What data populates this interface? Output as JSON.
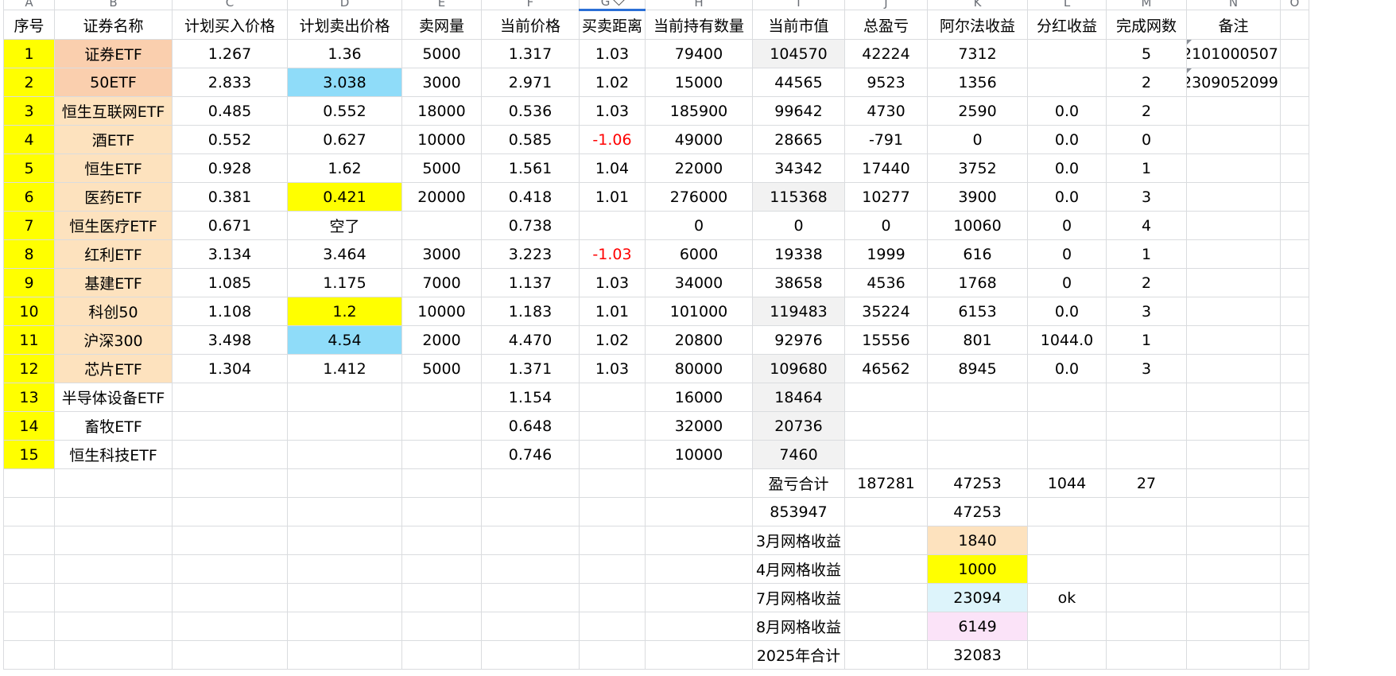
{
  "column_letters": [
    "A",
    "B",
    "C",
    "D",
    "E",
    "F",
    "G",
    "H",
    "I",
    "J",
    "K",
    "L",
    "M",
    "N",
    "O"
  ],
  "headers": [
    "序号",
    "证券名称",
    "计划买入价格",
    "计划卖出价格",
    "卖网量",
    "当前价格",
    "买卖距离",
    "当前持有数量",
    "当前市值",
    "总盈亏",
    "阿尔法收益",
    "分红收益",
    "完成网数",
    "备注"
  ],
  "rows": [
    {
      "no": "1",
      "name": "证券ETF",
      "buy": "1.267",
      "sell": "1.36",
      "qty": "5000",
      "price": "1.317",
      "dist": "1.03",
      "hold": "79400",
      "value": "104570",
      "pnl": "42224",
      "alpha": "7312",
      "div": "",
      "grids": "5",
      "note": "2101000507"
    },
    {
      "no": "2",
      "name": "50ETF",
      "buy": "2.833",
      "sell": "3.038",
      "qty": "3000",
      "price": "2.971",
      "dist": "1.02",
      "hold": "15000",
      "value": "44565",
      "pnl": "9523",
      "alpha": "1356",
      "div": "",
      "grids": "2",
      "note": "2309052099"
    },
    {
      "no": "3",
      "name": "恒生互联网ETF",
      "buy": "0.485",
      "sell": "0.552",
      "qty": "18000",
      "price": "0.536",
      "dist": "1.03",
      "hold": "185900",
      "value": "99642",
      "pnl": "4730",
      "alpha": "2590",
      "div": "0.0",
      "grids": "2",
      "note": ""
    },
    {
      "no": "4",
      "name": "酒ETF",
      "buy": "0.552",
      "sell": "0.627",
      "qty": "10000",
      "price": "0.585",
      "dist": "-1.06",
      "hold": "49000",
      "value": "28665",
      "pnl": "-791",
      "alpha": "0",
      "div": "0.0",
      "grids": "0",
      "note": ""
    },
    {
      "no": "5",
      "name": "恒生ETF",
      "buy": "0.928",
      "sell": "1.62",
      "qty": "5000",
      "price": "1.561",
      "dist": "1.04",
      "hold": "22000",
      "value": "34342",
      "pnl": "17440",
      "alpha": "3752",
      "div": "0.0",
      "grids": "1",
      "note": ""
    },
    {
      "no": "6",
      "name": "医药ETF",
      "buy": "0.381",
      "sell": "0.421",
      "qty": "20000",
      "price": "0.418",
      "dist": "1.01",
      "hold": "276000",
      "value": "115368",
      "pnl": "10277",
      "alpha": "3900",
      "div": "0.0",
      "grids": "3",
      "note": ""
    },
    {
      "no": "7",
      "name": "恒生医疗ETF",
      "buy": "0.671",
      "sell": "空了",
      "qty": "",
      "price": "0.738",
      "dist": "",
      "hold": "0",
      "value": "0",
      "pnl": "0",
      "alpha": "10060",
      "div": "0",
      "grids": "4",
      "note": ""
    },
    {
      "no": "8",
      "name": "红利ETF",
      "buy": "3.134",
      "sell": "3.464",
      "qty": "3000",
      "price": "3.223",
      "dist": "-1.03",
      "hold": "6000",
      "value": "19338",
      "pnl": "1999",
      "alpha": "616",
      "div": "0",
      "grids": "1",
      "note": ""
    },
    {
      "no": "9",
      "name": "基建ETF",
      "buy": "1.085",
      "sell": "1.175",
      "qty": "7000",
      "price": "1.137",
      "dist": "1.03",
      "hold": "34000",
      "value": "38658",
      "pnl": "4536",
      "alpha": "1768",
      "div": "0",
      "grids": "2",
      "note": ""
    },
    {
      "no": "10",
      "name": "科创50",
      "buy": "1.108",
      "sell": "1.2",
      "qty": "10000",
      "price": "1.183",
      "dist": "1.01",
      "hold": "101000",
      "value": "119483",
      "pnl": "35224",
      "alpha": "6153",
      "div": "0.0",
      "grids": "3",
      "note": ""
    },
    {
      "no": "11",
      "name": "沪深300",
      "buy": "3.498",
      "sell": "4.54",
      "qty": "2000",
      "price": "4.470",
      "dist": "1.02",
      "hold": "20800",
      "value": "92976",
      "pnl": "15556",
      "alpha": "801",
      "div": "1044.0",
      "grids": "1",
      "note": ""
    },
    {
      "no": "12",
      "name": "芯片ETF",
      "buy": "1.304",
      "sell": "1.412",
      "qty": "5000",
      "price": "1.371",
      "dist": "1.03",
      "hold": "80000",
      "value": "109680",
      "pnl": "46562",
      "alpha": "8945",
      "div": "0.0",
      "grids": "3",
      "note": ""
    },
    {
      "no": "13",
      "name": "半导体设备ETF",
      "buy": "",
      "sell": "",
      "qty": "",
      "price": "1.154",
      "dist": "",
      "hold": "16000",
      "value": "18464",
      "pnl": "",
      "alpha": "",
      "div": "",
      "grids": "",
      "note": ""
    },
    {
      "no": "14",
      "name": "畜牧ETF",
      "buy": "",
      "sell": "",
      "qty": "",
      "price": "0.648",
      "dist": "",
      "hold": "32000",
      "value": "20736",
      "pnl": "",
      "alpha": "",
      "div": "",
      "grids": "",
      "note": ""
    },
    {
      "no": "15",
      "name": "恒生科技ETF",
      "buy": "",
      "sell": "",
      "qty": "",
      "price": "0.746",
      "dist": "",
      "hold": "10000",
      "value": "7460",
      "pnl": "",
      "alpha": "",
      "div": "",
      "grids": "",
      "note": ""
    }
  ],
  "summary": {
    "label": "盈亏合计",
    "pnl_total": "187281",
    "alpha_total": "47253",
    "div_total": "1044",
    "grids_total": "27",
    "value_total": "853947",
    "alpha_total2": "47253"
  },
  "monthly": [
    {
      "label": "3月网格收益",
      "value": "1840",
      "bg": "#fde2be",
      "extra": ""
    },
    {
      "label": "4月网格收益",
      "value": "1000",
      "bg": "#ffff00",
      "extra": ""
    },
    {
      "label": "7月网格收益",
      "value": "23094",
      "bg": "#ddf4fb",
      "extra": "ok"
    },
    {
      "label": "8月网格收益",
      "value": "6149",
      "bg": "#fbe3f8",
      "extra": ""
    },
    {
      "label": "2025年合计",
      "value": "32083",
      "bg": "#ffffff",
      "extra": ""
    }
  ],
  "colors": {
    "no_bg": "#ffff00",
    "name_bg_orange": "#facfae",
    "name_bg_light": "#fde2be",
    "sell_blue": "#8fdcf9",
    "sell_yellow": "#ffff00",
    "value_grey": "#f2f2f2",
    "negative": "#ff0000",
    "header_active": "#2b6fd6"
  }
}
